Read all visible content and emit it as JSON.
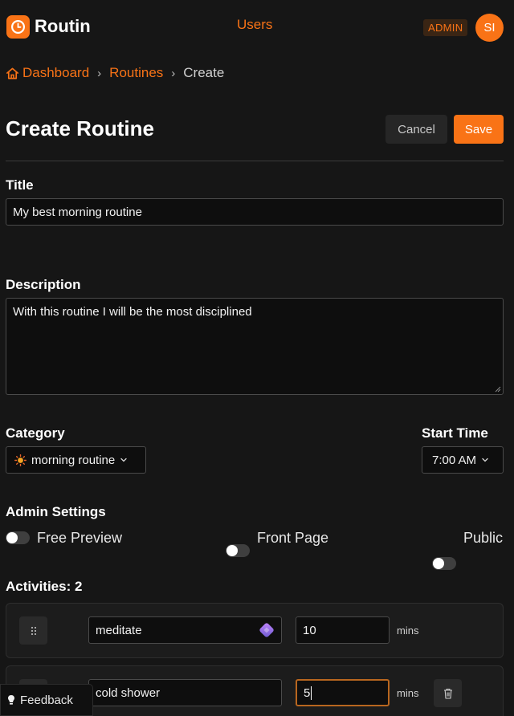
{
  "header": {
    "brand": "Routin",
    "nav_users": "Users",
    "role_badge": "ADMIN",
    "avatar_initials": "SI",
    "accent_color": "#f97316"
  },
  "breadcrumb": {
    "items": [
      "Dashboard",
      "Routines"
    ],
    "current": "Create",
    "separator": "›"
  },
  "page": {
    "title": "Create Routine",
    "cancel_label": "Cancel",
    "save_label": "Save"
  },
  "form": {
    "title_label": "Title",
    "title_value": "My best morning routine",
    "description_label": "Description",
    "description_value": "With this routine I will be the most disciplined",
    "category_label": "Category",
    "category_icon": "sun-icon",
    "category_value": "morning routine",
    "start_time_label": "Start Time",
    "start_time_value": "7:00 AM"
  },
  "admin_settings": {
    "heading": "Admin Settings",
    "toggles": [
      {
        "label": "Free Preview",
        "on": false
      },
      {
        "label": "Front Page",
        "on": false
      },
      {
        "label": "Public",
        "on": false
      }
    ]
  },
  "activities": {
    "heading": "Activities: 2",
    "items": [
      {
        "name": "meditate",
        "duration": "10",
        "unit": "mins"
      },
      {
        "name": "cold shower",
        "duration": "5",
        "unit": "mins"
      }
    ]
  },
  "feedback": {
    "label": "Feedback"
  }
}
